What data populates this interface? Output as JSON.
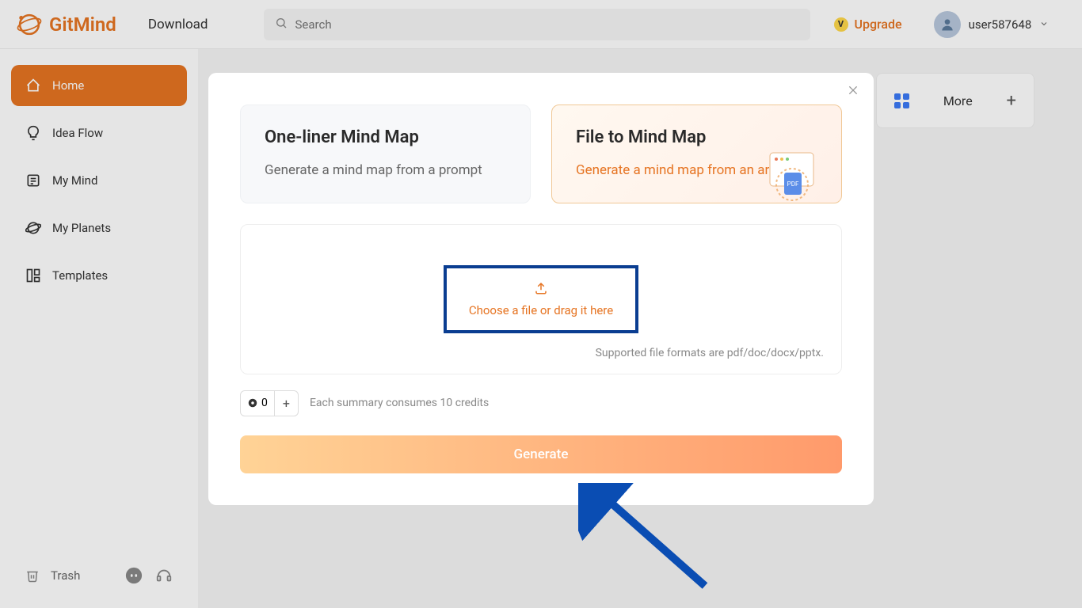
{
  "header": {
    "brand": "GitMind",
    "download": "Download",
    "search_placeholder": "Search",
    "upgrade": "Upgrade",
    "username": "user587648"
  },
  "sidebar": {
    "items": [
      {
        "label": "Home"
      },
      {
        "label": "Idea Flow"
      },
      {
        "label": "My Mind"
      },
      {
        "label": "My Planets"
      },
      {
        "label": "Templates"
      }
    ],
    "trash": "Trash"
  },
  "main": {
    "more": "More"
  },
  "modal": {
    "option_left": {
      "title": "One-liner Mind Map",
      "desc": "Generate a mind map from a prompt"
    },
    "option_right": {
      "title": "File to Mind Map",
      "desc": "Generate a mind map from an article"
    },
    "choose_file": "Choose a file or drag it here",
    "formats": "Supported file formats are pdf/doc/docx/pptx.",
    "credits_count": "0",
    "credits_hint": "Each summary consumes 10 credits",
    "generate": "Generate"
  }
}
